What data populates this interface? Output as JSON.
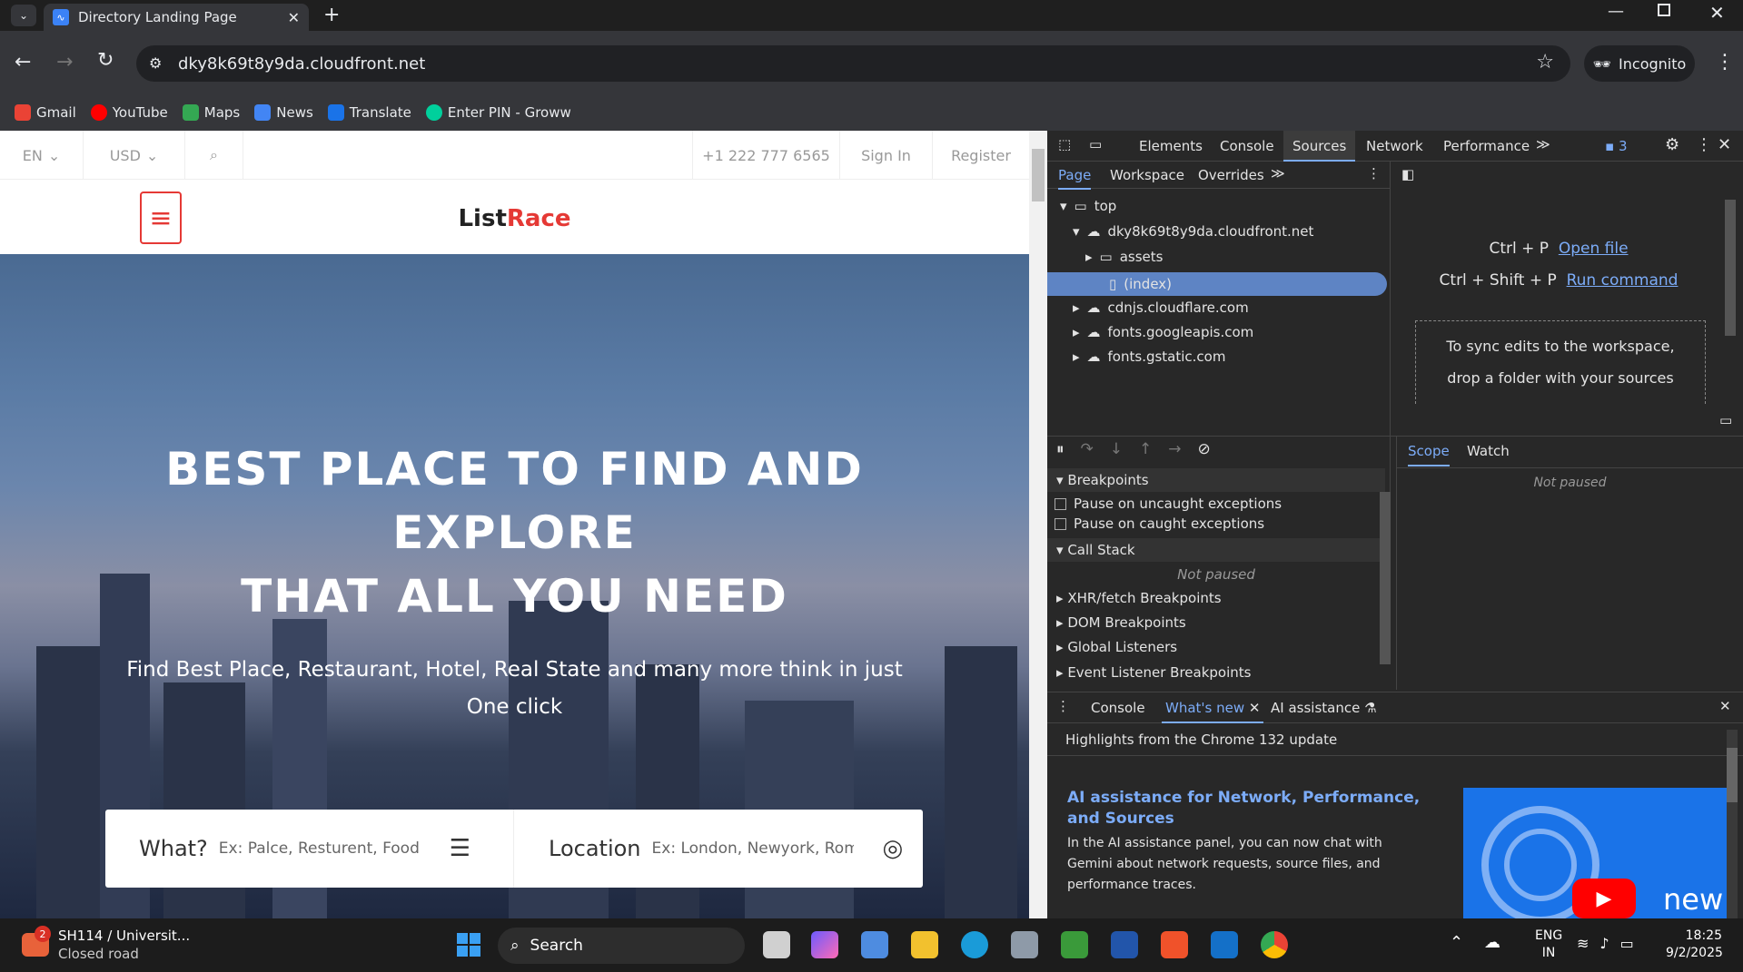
{
  "browser": {
    "tab_title": "Directory Landing Page",
    "url": "dky8k69t8y9da.cloudfront.net",
    "incognito_label": "Incognito",
    "bookmarks": [
      "Gmail",
      "YouTube",
      "Maps",
      "News",
      "Translate",
      "Enter PIN - Groww"
    ]
  },
  "site": {
    "lang": "EN",
    "currency": "USD",
    "phone": "+1 222 777 6565",
    "signin": "Sign In",
    "register": "Register",
    "logo_a": "List",
    "logo_b": "Race",
    "hero_line1": "BEST PLACE TO FIND AND",
    "hero_line2": "EXPLORE",
    "hero_line3": "THAT ALL YOU NEED",
    "hero_sub": "Find Best Place, Restaurant, Hotel, Real State and many more think in just One click",
    "what_label": "What?",
    "what_placeholder": "Ex: Palce, Resturent, Food,",
    "location_label": "Location",
    "location_placeholder": "Ex: London, Newyork, Rom"
  },
  "devtools": {
    "tabs": [
      "Elements",
      "Console",
      "Sources",
      "Network",
      "Performance"
    ],
    "active_tab": "Sources",
    "issues_count": "3",
    "nav_tabs": [
      "Page",
      "Workspace",
      "Overrides"
    ],
    "tree": {
      "top": "top",
      "domain": "dky8k69t8y9da.cloudfront.net",
      "assets": "assets",
      "index": "(index)",
      "cdn": "cdnjs.cloudflare.com",
      "gapis": "fonts.googleapis.com",
      "gstatic": "fonts.gstatic.com"
    },
    "shortcut1_keys": "Ctrl + P",
    "shortcut1_action": "Open file",
    "shortcut2_keys": "Ctrl + Shift + P",
    "shortcut2_action": "Run command",
    "workspace_hint_1": "To sync edits to the workspace,",
    "workspace_hint_2": "drop a folder with your sources",
    "breakpoints": "Breakpoints",
    "pause_uncaught": "Pause on uncaught exceptions",
    "pause_caught": "Pause on caught exceptions",
    "call_stack": "Call Stack",
    "not_paused": "Not paused",
    "xhr": "XHR/fetch Breakpoints",
    "dom": "DOM Breakpoints",
    "global": "Global Listeners",
    "event": "Event Listener Breakpoints",
    "scope": "Scope",
    "watch": "Watch",
    "drawer_console": "Console",
    "drawer_whatsnew": "What's new",
    "drawer_ai": "AI assistance",
    "highlights": "Highlights from the Chrome 132 update",
    "ai_title": "AI assistance for Network, Performance, and Sources",
    "ai_body": "In the AI assistance panel, you can now chat with Gemini about network requests, source files, and performance traces.",
    "video_word": "new"
  },
  "taskbar": {
    "weather_title": "SH114 / Universit...",
    "weather_sub": "Closed road",
    "weather_badge": "2",
    "search": "Search",
    "lang1": "ENG",
    "lang2": "IN",
    "time": "18:25",
    "date": "9/2/2025"
  }
}
